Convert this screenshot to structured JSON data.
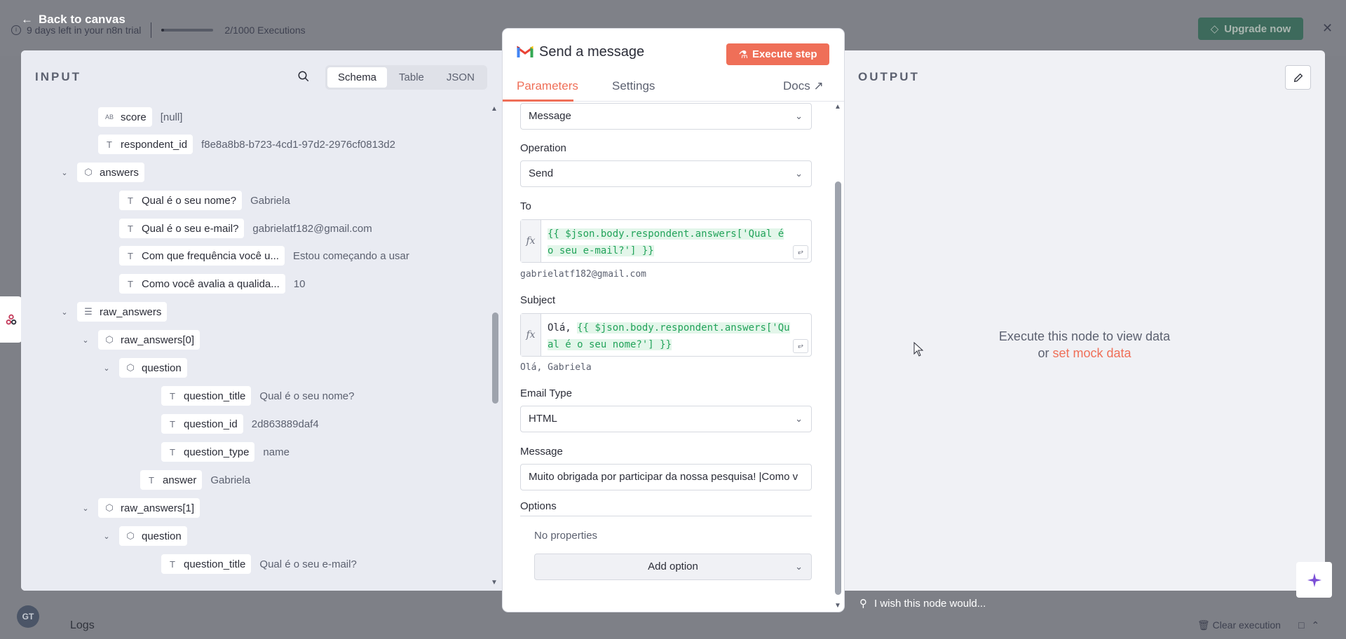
{
  "background": {
    "trial_text": "9 days left in your n8n trial",
    "executions": "2/1000 Executions",
    "executions_progress": 0.002,
    "upgrade_label": "Upgrade now",
    "back_label": "Back to canvas",
    "avatar_initials": "GT",
    "logs_label": "Logs",
    "clear_execution_label": "Clear execution"
  },
  "input": {
    "title": "INPUT",
    "view_tabs": [
      "Schema",
      "Table",
      "JSON"
    ],
    "active_view": "Schema"
  },
  "tree": [
    {
      "key": "score",
      "type_icon": "AB",
      "value": "[null]"
    },
    {
      "key": "respondent_id",
      "type_icon": "T",
      "value": "f8e8a8b8-b723-4cd1-97d2-2976cf0813d2"
    },
    {
      "key": "answers",
      "type_icon": "obj",
      "value": ""
    },
    {
      "key": "Qual é o seu nome?",
      "type_icon": "T",
      "value": "Gabriela"
    },
    {
      "key": "Qual é o seu e-mail?",
      "type_icon": "T",
      "value": "gabrielatf182@gmail.com"
    },
    {
      "key": "Com que frequência você u...",
      "type_icon": "T",
      "value": "Estou começando a usar"
    },
    {
      "key": "Como você avalia a qualida...",
      "type_icon": "T",
      "value": "10"
    },
    {
      "key": "raw_answers",
      "type_icon": "list",
      "value": ""
    },
    {
      "key": "raw_answers[0]",
      "type_icon": "obj",
      "value": ""
    },
    {
      "key": "question",
      "type_icon": "obj",
      "value": ""
    },
    {
      "key": "question_title",
      "type_icon": "T",
      "value": "Qual é o seu nome?"
    },
    {
      "key": "question_id",
      "type_icon": "T",
      "value": "2d863889daf4"
    },
    {
      "key": "question_type",
      "type_icon": "T",
      "value": "name"
    },
    {
      "key": "answer",
      "type_icon": "T",
      "value": "Gabriela"
    },
    {
      "key": "raw_answers[1]",
      "type_icon": "obj",
      "value": ""
    },
    {
      "key": "question",
      "type_icon": "obj",
      "value": ""
    },
    {
      "key": "question_title",
      "type_icon": "T",
      "value": "Qual é o seu e-mail?"
    }
  ],
  "node": {
    "title": "Send a message",
    "execute_label": "Execute step",
    "tabs": [
      "Parameters",
      "Settings"
    ],
    "docs_label": "Docs",
    "resource_value": "Message",
    "operation_label": "Operation",
    "operation_value": "Send",
    "to_label": "To",
    "to_expr": "{{ $json.body.respondent.answers['Qual é o seu e-mail?'] }}",
    "to_preview": "gabrielatf182@gmail.com",
    "subject_label": "Subject",
    "subject_prefix": "Olá, ",
    "subject_expr": "{{ $json.body.respondent.answers['Qual é o seu nome?'] }}",
    "subject_preview": "Olá, Gabriela",
    "email_type_label": "Email Type",
    "email_type_value": "HTML",
    "message_label": "Message",
    "message_value": "Muito obrigada por participar da nossa pesquisa! |Como v",
    "options_label": "Options",
    "no_properties": "No properties",
    "add_option_label": "Add option",
    "fx_label": "fx"
  },
  "output": {
    "title": "OUTPUT",
    "message_line1": "Execute this node to view data",
    "message_or": "or ",
    "mock_link": "set mock data",
    "wish_label": "I wish this node would..."
  },
  "colors": {
    "accent": "#ef6f58",
    "expression_green": "#22a35a",
    "upgrade_green": "#3d6a5c"
  }
}
